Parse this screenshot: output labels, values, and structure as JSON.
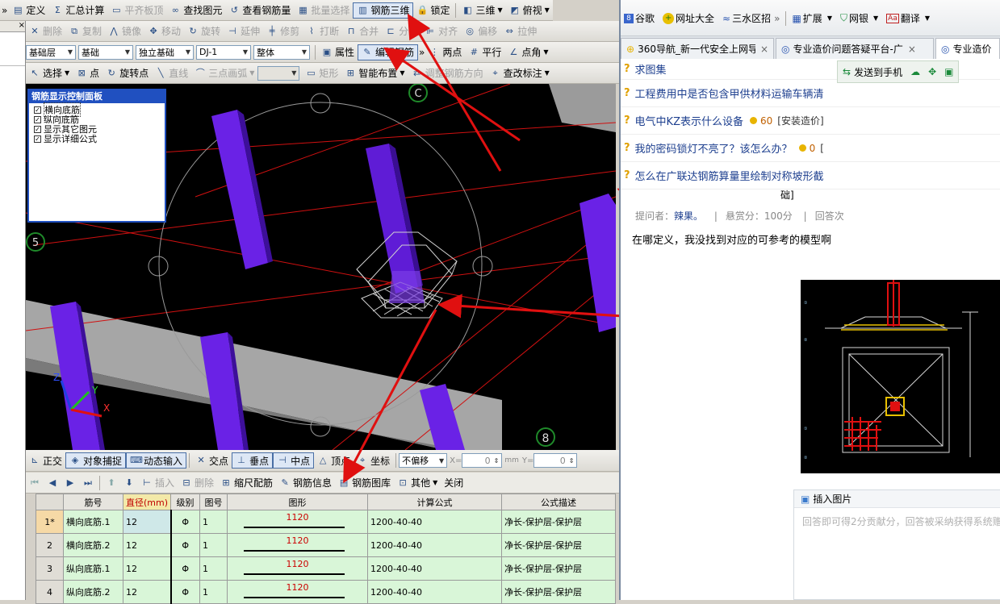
{
  "toolbar1": {
    "items": [
      {
        "label": "定义",
        "icon": "define-icon",
        "enabled": true
      },
      {
        "label": "汇总计算",
        "icon": "sigma-icon",
        "enabled": true
      },
      {
        "label": "平齐板顶",
        "icon": "align-top-icon",
        "enabled": false
      },
      {
        "label": "查找图元",
        "icon": "binoculars-icon",
        "enabled": true
      },
      {
        "label": "查看钢筋量",
        "icon": "rebar-view-icon",
        "enabled": true
      },
      {
        "label": "批量选择",
        "icon": "batch-select-icon",
        "enabled": false
      },
      {
        "label": "钢筋三维",
        "icon": "rebar-3d-icon",
        "enabled": true
      },
      {
        "label": "锁定",
        "icon": "lock-icon",
        "enabled": true
      },
      {
        "label": "三维",
        "icon": "cube-icon",
        "enabled": true
      },
      {
        "label": "俯视",
        "icon": "top-view-icon",
        "enabled": true
      }
    ]
  },
  "toolbar2": {
    "items": [
      {
        "label": "删除",
        "icon": "delete-icon"
      },
      {
        "label": "复制",
        "icon": "copy-icon"
      },
      {
        "label": "镜像",
        "icon": "mirror-icon"
      },
      {
        "label": "移动",
        "icon": "move-icon"
      },
      {
        "label": "旋转",
        "icon": "rotate-icon"
      },
      {
        "label": "延伸",
        "icon": "extend-icon"
      },
      {
        "label": "修剪",
        "icon": "trim-icon"
      },
      {
        "label": "打断",
        "icon": "break-icon"
      },
      {
        "label": "合并",
        "icon": "merge-icon"
      },
      {
        "label": "分割",
        "icon": "split-icon"
      },
      {
        "label": "对齐",
        "icon": "align-icon"
      },
      {
        "label": "偏移",
        "icon": "offset-icon"
      },
      {
        "label": "拉伸",
        "icon": "stretch-icon"
      }
    ]
  },
  "toolbar3": {
    "combos": [
      "基础层",
      "基础",
      "独立基础",
      "DJ-1",
      "整体"
    ],
    "buttons": [
      {
        "label": "属性",
        "icon": "properties-icon"
      },
      {
        "label": "编辑钢筋",
        "icon": "edit-rebar-icon"
      },
      {
        "label": "两点",
        "icon": "two-point-icon"
      },
      {
        "label": "平行",
        "icon": "parallel-icon"
      },
      {
        "label": "点角",
        "icon": "point-angle-icon"
      }
    ]
  },
  "toolbar4": {
    "items": [
      {
        "label": "选择",
        "icon": "select-icon",
        "enabled": true
      },
      {
        "label": "点",
        "icon": "point-icon",
        "enabled": true
      },
      {
        "label": "旋转点",
        "icon": "rotate-point-icon",
        "enabled": true
      },
      {
        "label": "直线",
        "icon": "line-icon",
        "enabled": false
      },
      {
        "label": "三点画弧",
        "icon": "arc-icon",
        "enabled": false
      },
      {
        "label": "矩形",
        "icon": "rect-icon",
        "enabled": false
      },
      {
        "label": "智能布置",
        "icon": "smart-layout-icon",
        "enabled": true
      },
      {
        "label": "调整钢筋方向",
        "icon": "adjust-rebar-icon",
        "enabled": false
      },
      {
        "label": "查改标注",
        "icon": "annotation-icon",
        "enabled": true
      }
    ]
  },
  "panel": {
    "title": "钢筋显示控制面板",
    "options": [
      "横向底筋",
      "纵向底筋",
      "显示其它图元",
      "显示详细公式"
    ]
  },
  "axis_labels": {
    "c": "C",
    "five": "5",
    "eight": "8",
    "x": "X",
    "y": "Y",
    "z": "Z"
  },
  "snapbar": {
    "items": [
      "正交",
      "对象捕捉",
      "动态输入",
      "交点",
      "垂点",
      "中点",
      "顶点",
      "坐标"
    ],
    "offset_mode": "不偏移",
    "x_label": "X=",
    "x_value": "0",
    "unit": "mm",
    "y_label": "Y=",
    "y_value": "0"
  },
  "table_toolbar": {
    "items": [
      "插入",
      "删除",
      "缩尺配筋",
      "钢筋信息",
      "钢筋图库",
      "其他",
      "关闭"
    ]
  },
  "table": {
    "headers": [
      "筋号",
      "直径(mm)",
      "级别",
      "图号",
      "图形",
      "计算公式",
      "公式描述"
    ],
    "rows": [
      {
        "num": "1*",
        "name": "横向底筋.1",
        "dia": "12",
        "grade": "Φ",
        "fig": "1",
        "shape": "1120",
        "formula": "1200-40-40",
        "desc": "净长-保护层-保护层"
      },
      {
        "num": "2",
        "name": "横向底筋.2",
        "dia": "12",
        "grade": "Φ",
        "fig": "1",
        "shape": "1120",
        "formula": "1200-40-40",
        "desc": "净长-保护层-保护层"
      },
      {
        "num": "3",
        "name": "纵向底筋.1",
        "dia": "12",
        "grade": "Φ",
        "fig": "1",
        "shape": "1120",
        "formula": "1200-40-40",
        "desc": "净长-保护层-保护层"
      },
      {
        "num": "4",
        "name": "纵向底筋.2",
        "dia": "12",
        "grade": "Φ",
        "fig": "1",
        "shape": "1120",
        "formula": "1200-40-40",
        "desc": "净长-保护层-保护层"
      }
    ]
  },
  "browser": {
    "bookmarks": [
      "谷歌",
      "网址大全",
      "三水区招"
    ],
    "tools": [
      "扩展",
      "网银",
      "翻译"
    ],
    "tabs": [
      "360导航_新一代安全上网导",
      "专业造价问题答疑平台-广",
      "专业造价"
    ],
    "send_to_phone": "发送到手机",
    "questions": [
      {
        "text": "求图集",
        "coins": "",
        "tag": ""
      },
      {
        "text": "工程费用中是否包含甲供材料运输车辆清",
        "coins": "",
        "tag": ""
      },
      {
        "text": "电气中KZ表示什么设备",
        "coins": "60",
        "tag": "[安装造价]"
      },
      {
        "text": "我的密码锁灯不亮了？该怎么办？",
        "coins": "0",
        "tag": "["
      },
      {
        "text": "怎么在广联达钢筋算量里绘制对称坡形截",
        "coins": "",
        "tag": ""
      }
    ],
    "wrap_text": "础]",
    "meta": {
      "asker_label": "提问者：",
      "asker": "辣果。",
      "reward": "悬赏分：100分",
      "answers": "回答次"
    },
    "body_text": "在哪定义，我没找到对应的可参考的模型啊",
    "insert_image": "插入图片",
    "answer_placeholder": "回答即可得2分贡献分，回答被采纳获得系统赠"
  },
  "colors": {
    "accent": "#2050c0",
    "column": "#6a22e6",
    "grid_line": "#d01010",
    "arrow": "#e01010",
    "table_bg": "#d9f6d8"
  }
}
